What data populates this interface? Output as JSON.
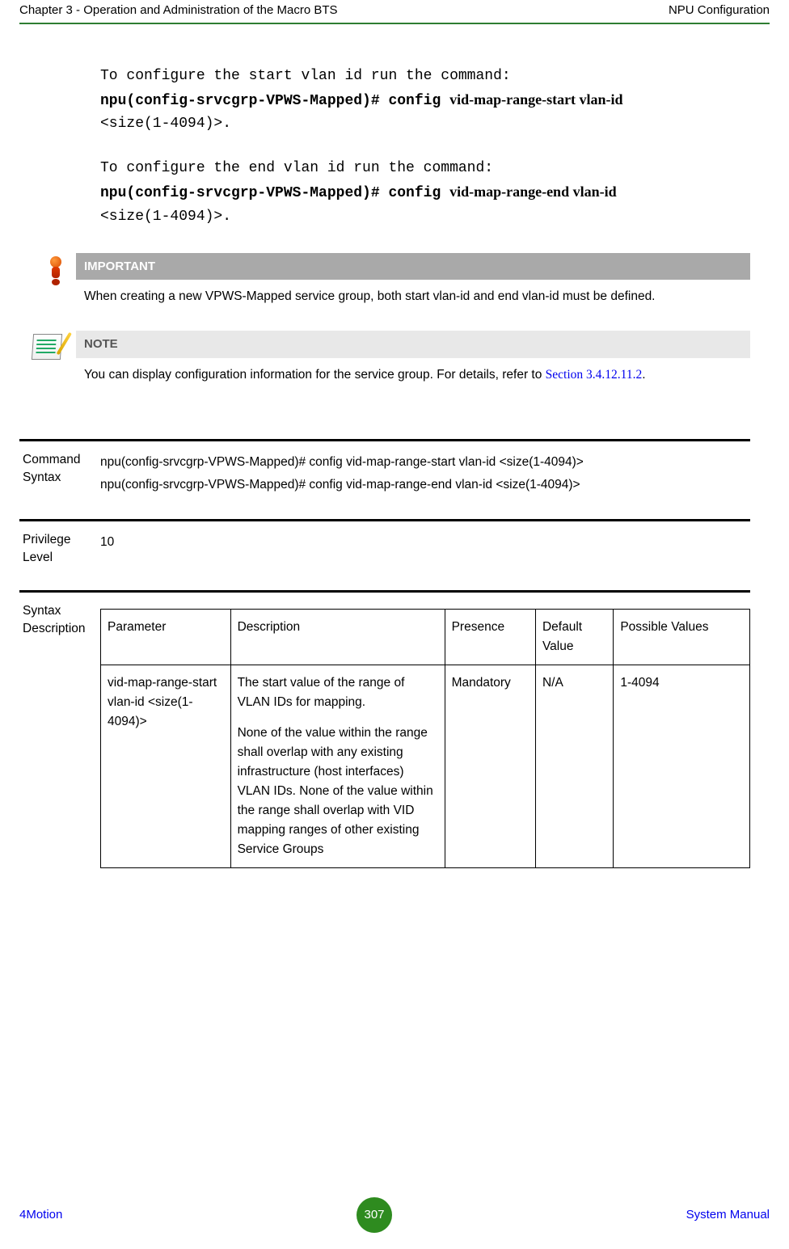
{
  "header": {
    "left": "Chapter 3 - Operation and Administration of the Macro BTS",
    "right": "NPU Configuration"
  },
  "intro": {
    "line1": "To configure the start vlan id run the command:",
    "cmd1_prefix": "npu(config-srvcgrp-VPWS-Mapped)# config ",
    "cmd1_suffix": "vid-map-range-start vlan-id",
    "size1": "<size(1-4094)>.",
    "line2": "To configure the end vlan id run the command:",
    "cmd2_prefix": "npu(config-srvcgrp-VPWS-Mapped)# config ",
    "cmd2_suffix": "vid-map-range-end vlan-id",
    "size2": "<size(1-4094)>."
  },
  "important": {
    "title": "IMPORTANT",
    "text": "When creating a new VPWS-Mapped service group, both start vlan-id and end vlan-id must be defined."
  },
  "note": {
    "title": "NOTE",
    "text": "You can display configuration information for the service group. For details, refer to ",
    "ref": "Section 3.4.12.11.2",
    "tail": "."
  },
  "specs": {
    "commandSyntax": {
      "label": "Command Syntax",
      "value1": "npu(config-srvcgrp-VPWS-Mapped)# config vid-map-range-start vlan-id <size(1-4094)>",
      "value2": "npu(config-srvcgrp-VPWS-Mapped)# config vid-map-range-end vlan-id <size(1-4094)>"
    },
    "privilege": {
      "label": "Privilege Level",
      "value": "10"
    },
    "syntaxDescription": {
      "label": "Syntax Description",
      "headers": [
        "Parameter",
        "Description",
        "Presence",
        "Default Value",
        "Possible Values"
      ],
      "rows": [
        {
          "parameter": "vid-map-range-start vlan-id <size(1-4094)>",
          "description_p1": "The start value of the range of VLAN IDs for mapping.",
          "description_p2": "None of the value within the range shall overlap with any existing infrastructure (host interfaces) VLAN IDs. None of the value within the range shall overlap with VID mapping ranges of other existing Service Groups",
          "presence": "Mandatory",
          "default": "N/A",
          "possible": "1-4094"
        }
      ]
    }
  },
  "footer": {
    "left": "4Motion",
    "page": "307",
    "right": "System Manual"
  }
}
